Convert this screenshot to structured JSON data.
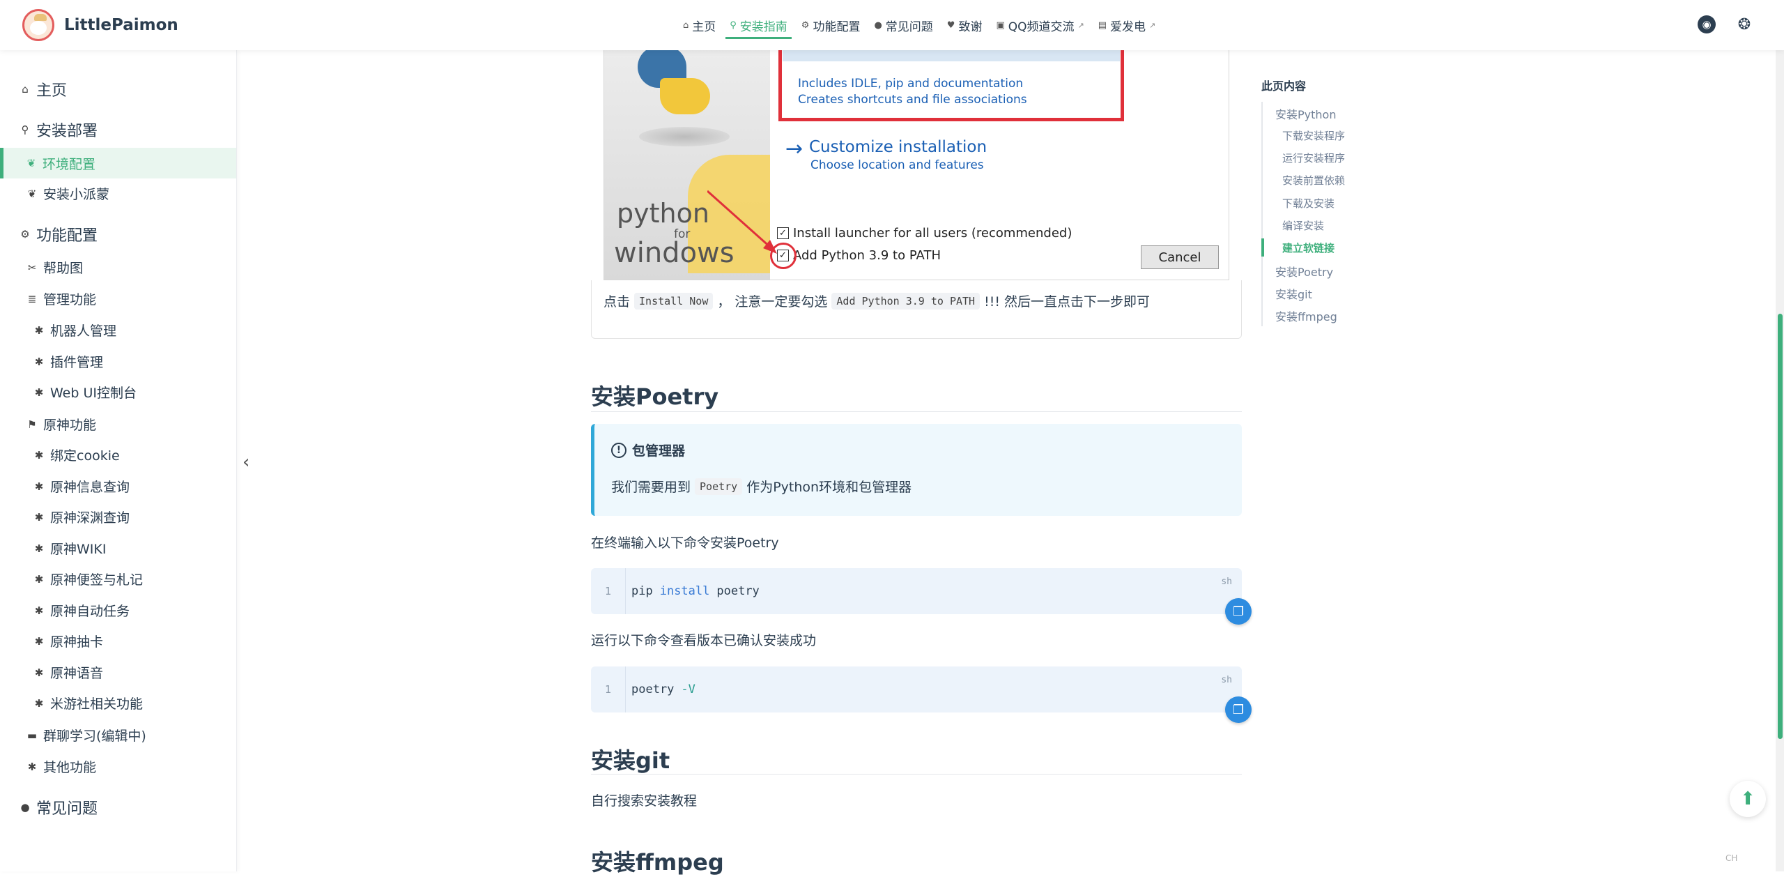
{
  "brand": {
    "name": "LittlePaimon"
  },
  "nav": {
    "items": [
      {
        "label": "主页",
        "icon": "home-icon"
      },
      {
        "label": "安装指南",
        "icon": "map-pin-icon",
        "active": true
      },
      {
        "label": "功能配置",
        "icon": "settings-icon"
      },
      {
        "label": "常见问题",
        "icon": "question-icon"
      },
      {
        "label": "致谢",
        "icon": "heart-icon"
      },
      {
        "label": "QQ频道交流",
        "icon": "chat-icon",
        "external": true
      },
      {
        "label": "爱发电",
        "icon": "charge-icon",
        "external": true
      }
    ],
    "right_icons": [
      "github-icon",
      "theme-toggle-icon"
    ]
  },
  "sidebar": {
    "home": "主页",
    "install_section": "安装部署",
    "env_config": "环境配置",
    "install_paimon": "安装小派蒙",
    "feature_section": "功能配置",
    "help_map": "帮助图",
    "manage": "管理功能",
    "robot_manage": "机器人管理",
    "plugin_manage": "插件管理",
    "webui": "Web UI控制台",
    "genshin": "原神功能",
    "bind_cookie": "绑定cookie",
    "info_query": "原神信息查询",
    "abyss_query": "原神深渊查询",
    "wiki": "原神WIKI",
    "notes": "原神便签与札记",
    "auto_tasks": "原神自动任务",
    "gacha": "原神抽卡",
    "voice": "原神语音",
    "miyoushe": "米游社相关功能",
    "group_learning": "群聊学习(编辑中)",
    "other": "其他功能",
    "faq": "常见问题"
  },
  "toc": {
    "title": "此页内容",
    "items": [
      {
        "label": "安装Python",
        "level": 1
      },
      {
        "label": "下载安装程序",
        "level": 2
      },
      {
        "label": "运行安装程序",
        "level": 2
      },
      {
        "label": "安装前置依赖",
        "level": 2
      },
      {
        "label": "下载及安装",
        "level": 2
      },
      {
        "label": "编译安装",
        "level": 2
      },
      {
        "label": "建立软链接",
        "level": 2,
        "active": true
      },
      {
        "label": "安装Poetry",
        "level": 1
      },
      {
        "label": "安装git",
        "level": 1
      },
      {
        "label": "安装ffmpeg",
        "level": 1
      }
    ]
  },
  "installer": {
    "line1": "Includes IDLE, pip and documentation",
    "line2": "Creates shortcuts and file associations",
    "customize_title": "Customize installation",
    "customize_sub": "Choose location and features",
    "python_word": "python",
    "for_word": "for",
    "windows_word": "windows",
    "check1": "Install launcher for all users (recommended)",
    "check2": "Add Python 3.9 to PATH",
    "cancel": "Cancel"
  },
  "content": {
    "click_text_a": "点击",
    "install_now_code": "Install Now",
    "click_text_b": "，  注意一定要勾选",
    "add_path_code": "Add Python 3.9 to PATH",
    "click_text_c": "!!! 然后一直点击下一步即可",
    "h_poetry": "安装Poetry",
    "tip_title": "包管理器",
    "tip_body_a": "我们需要用到",
    "tip_body_code": "Poetry",
    "tip_body_b": "作为Python环境和包管理器",
    "poetry_intro": "在终端输入以下命令安装Poetry",
    "code1": {
      "line": "1",
      "lang": "sh",
      "cmd": "pip",
      "kw": "install",
      "arg": "poetry"
    },
    "verify_text": "运行以下命令查看版本已确认安装成功",
    "code2": {
      "line": "1",
      "lang": "sh",
      "cmd": "poetry",
      "flag": "-V"
    },
    "h_git": "安装git",
    "git_text": "自行搜索安装教程",
    "h_ffmpeg": "安装ffmpeg"
  },
  "misc": {
    "ime_indicator": "CH",
    "accent_color": "#3eaf7c",
    "tip_border_color": "#2fa8d8",
    "annotation_color": "#e0303a"
  }
}
